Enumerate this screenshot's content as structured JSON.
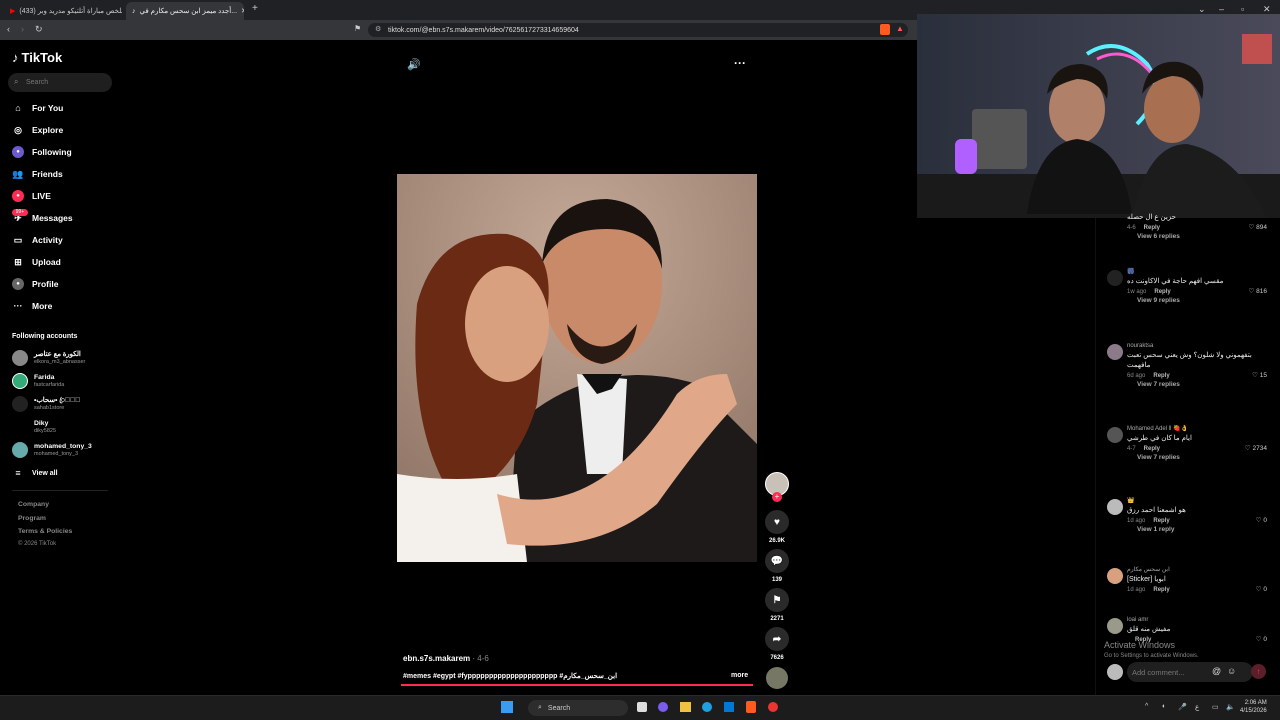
{
  "browser": {
    "tabs": [
      {
        "title": "(433) ملخص مباراة أتلتيكو مدريد وبر...",
        "icon": "youtube-icon"
      },
      {
        "title": "أجدد ميمز ابن سحس مكارم في...",
        "icon": "tiktok-icon"
      }
    ],
    "url": "tiktok.com/@ebn.s7s.makarem/video/7625617273314659604"
  },
  "tiktok": {
    "logo": "TikTok",
    "search_placeholder": "Search",
    "nav": [
      {
        "label": "For You",
        "icon": "home-icon"
      },
      {
        "label": "Explore",
        "icon": "compass-icon"
      },
      {
        "label": "Following",
        "icon": "following-icon"
      },
      {
        "label": "Friends",
        "icon": "friends-icon"
      },
      {
        "label": "LIVE",
        "icon": "live-icon"
      },
      {
        "label": "Messages",
        "icon": "messages-icon"
      },
      {
        "label": "Activity",
        "icon": "activity-icon"
      },
      {
        "label": "Upload",
        "icon": "upload-icon"
      },
      {
        "label": "Profile",
        "icon": "profile-icon"
      },
      {
        "label": "More",
        "icon": "more-icon"
      }
    ],
    "following_header": "Following accounts",
    "accounts": [
      {
        "name": "الكورة مع عتاصر",
        "handle": "elkora_m3_abnasser"
      },
      {
        "name": "Farida",
        "handle": "fastcarfarida"
      },
      {
        "name": "•سحاب•  ꦿ𝓐🌨ꦿ",
        "handle": "sahab1store"
      },
      {
        "name": "Diky",
        "handle": "diky5825"
      },
      {
        "name": "mohamed_tony_3",
        "handle": "mohamed_tony_3"
      }
    ],
    "view_all": "View all",
    "footer": [
      "Company",
      "Program",
      "Terms & Policies",
      "© 2026 TikTok"
    ],
    "video": {
      "author": "ebn.s7s.makarem",
      "date": "· 4-6",
      "caption": "#memes #egypt #fyppppppppppppppppppppp #ابن_سحس_مكارم",
      "more": "more",
      "likes": "26.9K",
      "comments": "139",
      "saves": "2271",
      "shares": "7626"
    },
    "comments": [
      {
        "user": "",
        "text": "حزين ع ال حصله",
        "date": "4-6",
        "reply": "Reply",
        "likes": "894",
        "view": "View 6 replies"
      },
      {
        "user": "🎆",
        "text": "مقسي افهم حاجة في الاكاونت ده",
        "date": "1w ago",
        "reply": "Reply",
        "likes": "816",
        "view": "View 9 replies"
      },
      {
        "user": "nouraktsa",
        "text": "بتفهموني ولا شلون؟ وش يعني سحس تعبت مافهمت",
        "date": "6d ago",
        "reply": "Reply",
        "likes": "15",
        "view": "View 7 replies"
      },
      {
        "user": "Mohamed Adel ll 🍓👌",
        "text": "ايام ما كان في طرشي",
        "date": "4-7",
        "reply": "Reply",
        "likes": "2734",
        "view": "View 7 replies"
      },
      {
        "user": "👑",
        "text": "هو اشمعنا احمد رزق",
        "date": "1d ago",
        "reply": "Reply",
        "likes": "0",
        "view": "View 1 reply"
      },
      {
        "user": "ابن سحس مكارم",
        "text": "[Sticker] ابويا",
        "date": "1d ago",
        "reply": "Reply",
        "likes": "0",
        "view": ""
      },
      {
        "user": "loai amr",
        "text": "مفيش منه قلق",
        "date": "",
        "reply": "Reply",
        "likes": "0",
        "view": ""
      }
    ],
    "add_comment": "Add comment..."
  },
  "watermark": {
    "line1": "Activate Windows",
    "line2": "Go to Settings to activate Windows."
  },
  "taskbar": {
    "search": "Search",
    "time": "2:06 AM",
    "date": "4/15/2026",
    "lang": "ع"
  }
}
